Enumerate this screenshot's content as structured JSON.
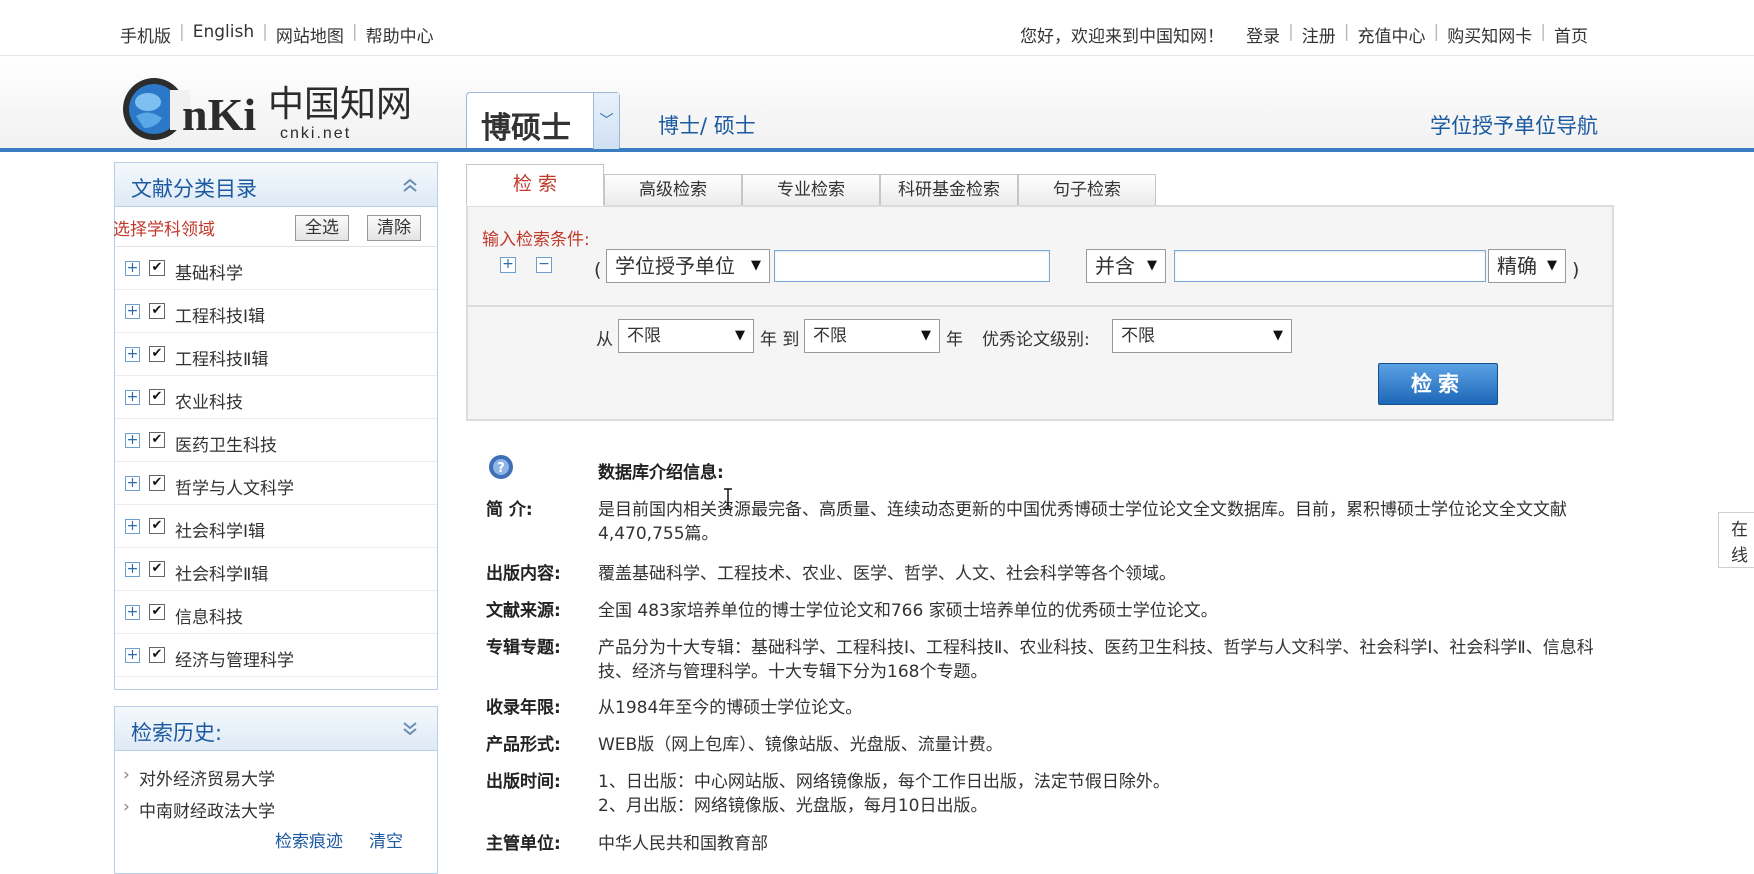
{
  "top_left_links": [
    "手机版",
    "English",
    "网站地图",
    "帮助中心"
  ],
  "top_right": {
    "welcome": "您好，欢迎来到中国知网！",
    "links": [
      "登录",
      "注册",
      "充值中心",
      "购买知网卡",
      "首页"
    ]
  },
  "header": {
    "logo_text": "CNKi中国知网",
    "logo_url_text": "cnki.net",
    "db_select": "博硕士",
    "subtitle": "博士/ 硕士",
    "unit_nav": "学位授予单位导航"
  },
  "sidebar": {
    "title": "文献分类目录",
    "pick_label": "选择学科领域",
    "select_all": "全选",
    "clear": "清除",
    "categories": [
      "基础科学",
      "工程科技Ⅰ辑",
      "工程科技Ⅱ辑",
      "农业科技",
      "医药卫生科技",
      "哲学与人文科学",
      "社会科学Ⅰ辑",
      "社会科学Ⅱ辑",
      "信息科技",
      "经济与管理科学"
    ],
    "checked_mark": "✔",
    "history_title": "检索历史:",
    "history": [
      "对外经济贸易大学",
      "中南财经政法大学"
    ],
    "history_trace": "检索痕迹",
    "history_clear": "清空"
  },
  "search": {
    "tabs": [
      "检 索",
      "高级检索",
      "专业检索",
      "科研基金检索",
      "句子检索"
    ],
    "condition_label": "输入检索条件:",
    "field": "学位授予单位",
    "relation": "并含",
    "match": "精确",
    "from_label": "从",
    "year_from": "不限",
    "year_mid": "年 到",
    "year_to": "不限",
    "year_end": "年",
    "level_label": "优秀论文级别:",
    "level": "不限",
    "button": "检索"
  },
  "intro": {
    "heading": "数据库介绍信息:",
    "rows": [
      {
        "k": "简    介:",
        "v": "是目前国内相关资源最完备、高质量、连续动态更新的中国优秀博硕士学位论文全文数据库。目前，累积博硕士学位论文全文文献4,470,755篇。"
      },
      {
        "k": "出版内容:",
        "v": "覆盖基础科学、工程技术、农业、医学、哲学、人文、社会科学等各个领域。"
      },
      {
        "k": "文献来源:",
        "v": "全国 483家培养单位的博士学位论文和766 家硕士培养单位的优秀硕士学位论文。"
      },
      {
        "k": "专辑专题:",
        "v": "产品分为十大专辑：基础科学、工程科技Ⅰ、工程科技Ⅱ、农业科技、医药卫生科技、哲学与人文科学、社会科学Ⅰ、社会科学Ⅱ、信息科技、经济与管理科学。十大专辑下分为168个专题。"
      },
      {
        "k": "收录年限:",
        "v": "从1984年至今的博硕士学位论文。"
      },
      {
        "k": "产品形式:",
        "v": "WEB版（网上包库）、镜像站版、光盘版、流量计费。"
      },
      {
        "k": "出版时间:",
        "v": "1、日出版：中心网站版、网络镜像版，每个工作日出版，法定节假日除外。\n2、月出版：网络镜像版、光盘版，每月10日出版。"
      },
      {
        "k": "主管单位:",
        "v": "中华人民共和国教育部"
      }
    ]
  },
  "side_consult": "在线咨询"
}
